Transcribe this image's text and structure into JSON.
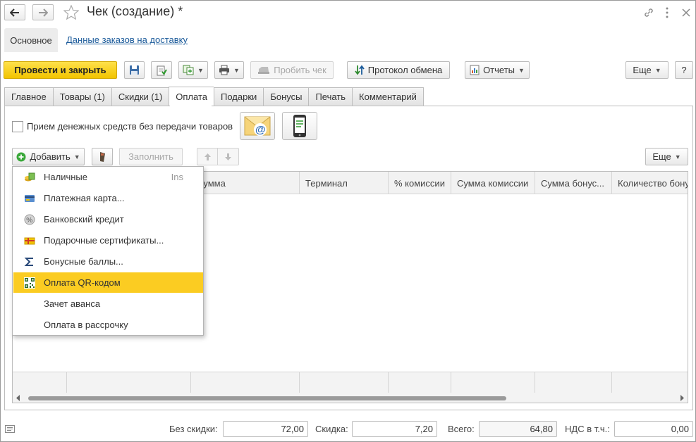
{
  "window": {
    "title": "Чек (создание) *"
  },
  "panel": {
    "active_tab": "Основное",
    "link": "Данные заказов на доставку"
  },
  "toolbar": {
    "post_close": "Провести и закрыть",
    "print_check": "Пробить чек",
    "exchange_log": "Протокол обмена",
    "reports": "Отчеты",
    "more": "Еще",
    "help": "?"
  },
  "tabs": [
    "Главное",
    "Товары (1)",
    "Скидки (1)",
    "Оплата",
    "Подарки",
    "Бонусы",
    "Печать",
    "Комментарий"
  ],
  "active_tab_index": 3,
  "checkbox": {
    "label": "Прием денежных средств без передачи товаров",
    "checked": false
  },
  "subtoolbar": {
    "add": "Добавить",
    "fill": "Заполнить",
    "more": "Еще"
  },
  "table": {
    "columns": [
      "Сумма",
      "Терминал",
      "% комиссии",
      "Сумма комиссии",
      "Сумма бонус...",
      "Количество бонусов"
    ]
  },
  "menu": {
    "items": [
      {
        "label": "Наличные",
        "shortcut": "Ins",
        "icon": "cash-icon"
      },
      {
        "label": "Платежная карта...",
        "shortcut": "",
        "icon": "payment-card-icon"
      },
      {
        "label": "Банковский кредит",
        "shortcut": "",
        "icon": "percent-icon"
      },
      {
        "label": "Подарочные сертификаты...",
        "shortcut": "",
        "icon": "gift-certificate-icon"
      },
      {
        "label": "Бонусные баллы...",
        "shortcut": "",
        "icon": "sigma-icon"
      },
      {
        "label": "Оплата QR-кодом",
        "shortcut": "",
        "icon": "qr-code-icon",
        "highlighted": true
      },
      {
        "label": "Зачет аванса",
        "shortcut": "",
        "icon": ""
      },
      {
        "label": "Оплата в рассрочку",
        "shortcut": "",
        "icon": ""
      }
    ]
  },
  "footer": {
    "no_discount_label": "Без скидки:",
    "no_discount_value": "72,00",
    "discount_label": "Скидка:",
    "discount_value": "7,20",
    "total_label": "Всего:",
    "total_value": "64,80",
    "vat_label": "НДС в т.ч.:",
    "vat_value": "0,00"
  },
  "colors": {
    "primary_button": "#f5c800",
    "highlight": "#fbcc22",
    "link": "#1a5a9a"
  }
}
